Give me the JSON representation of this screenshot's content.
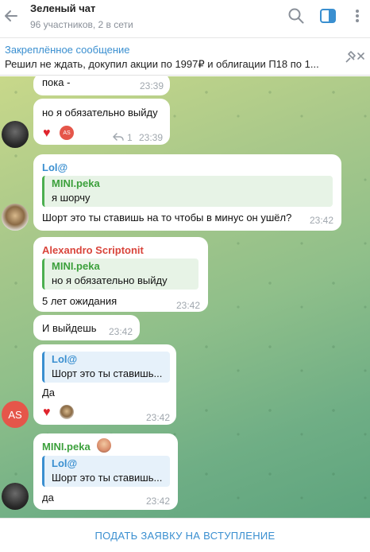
{
  "header": {
    "title": "Зеленый чат",
    "subtitle": "96 участников, 2 в сети"
  },
  "pinned": {
    "title": "Закреплённое сообщение",
    "text": "Решил не ждать, докупил акции по 1997₽ и облигации П18 по 1..."
  },
  "messages": [
    {
      "text": "пока -",
      "time": "23:39"
    },
    {
      "text": "но я обязательно выйду",
      "time": "23:39",
      "reply_count": "1",
      "reaction_initials": "AS"
    },
    {
      "sender": "Lol@",
      "reply_name": "MINI.peka",
      "reply_text": "я шорчу",
      "text": "Шорт это ты ставишь на то чтобы в минус он ушёл?",
      "time": "23:42"
    },
    {
      "sender": "Alexandro Scriptonit",
      "reply_name": "MINI.peka",
      "reply_text": "но я обязательно выйду",
      "text": "5 лет ожидания",
      "time": "23:42"
    },
    {
      "text": "И выйдешь",
      "time": "23:42"
    },
    {
      "reply_name": "Lol@",
      "reply_text": "Шорт это ты ставишь...",
      "text": "Да",
      "time": "23:42",
      "avatar_initials": "AS"
    },
    {
      "sender": "MINI.peka",
      "reply_name": "Lol@",
      "reply_text": "Шорт это ты ставишь...",
      "text": "да",
      "time": "23:42"
    }
  ],
  "footer": {
    "join_label": "ПОДАТЬ ЗАЯВКУ НА ВСТУПЛЕНИЕ"
  },
  "colors": {
    "accent": "#3a8fd0",
    "sender_green": "#3ca03c",
    "sender_red": "#d9453c",
    "heart": "#e0242d"
  }
}
